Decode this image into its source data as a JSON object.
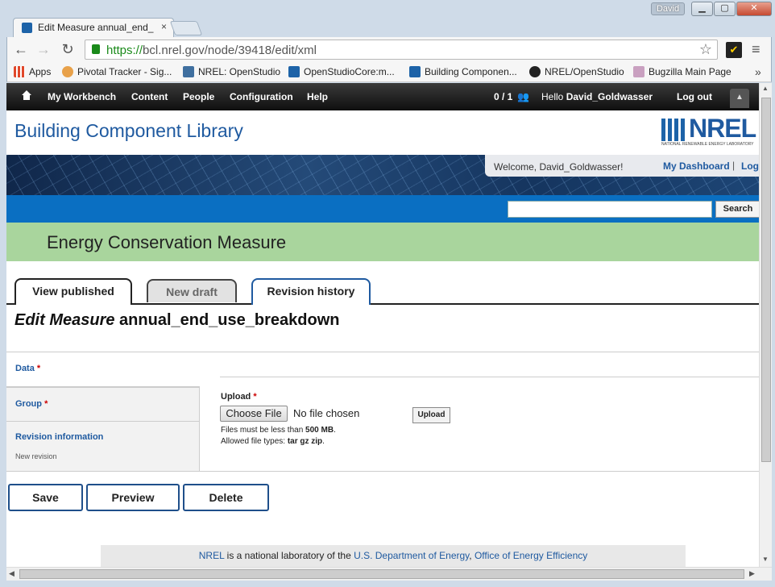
{
  "window": {
    "user_badge": "David",
    "minimize": "▁",
    "maximize": "▢",
    "close": "✕"
  },
  "tab": {
    "title": "Edit Measure annual_end_",
    "close": "×"
  },
  "toolbar": {
    "url_scheme": "https://",
    "url_rest": "bcl.nrel.gov/node/39418/edit/xml",
    "star": "☆",
    "back": "←",
    "forward": "→",
    "reload": "↻",
    "menu": "≡"
  },
  "bookmarks": {
    "items": [
      {
        "label": "Apps",
        "icon": "apps-grid-icon",
        "color": "#e0472a"
      },
      {
        "label": "Pivotal Tracker - Sig...",
        "icon": "pivotal-tracker-icon",
        "color": "#e8a14a"
      },
      {
        "label": "NREL: OpenStudio",
        "icon": "openstudio-icon",
        "color": "#3f6f9f"
      },
      {
        "label": "OpenStudioCore:m...",
        "icon": "openstudio-core-icon",
        "color": "#1d63a8"
      },
      {
        "label": "Building Componen...",
        "icon": "bcl-icon",
        "color": "#1d63a8"
      },
      {
        "label": "NREL/OpenStudio",
        "icon": "github-icon",
        "color": "#222222"
      },
      {
        "label": "Bugzilla Main Page",
        "icon": "bugzilla-icon",
        "color": "#c9a0c0"
      }
    ],
    "more": "»"
  },
  "admin": {
    "workbench": "My Workbench",
    "content": "Content",
    "people": "People",
    "configuration": "Configuration",
    "help": "Help",
    "users": "0 / 1",
    "hello_prefix": "Hello ",
    "hello_user": "David_Goldwasser",
    "logout": "Log out",
    "toggle": "▲"
  },
  "site": {
    "name": "Building Component Library",
    "logo": "NREL",
    "logo_sub": "NATIONAL RENEWABLE ENERGY LABORATORY"
  },
  "welcome": {
    "text": "Welcome, David_Goldwasser!",
    "dashboard": "My Dashboard",
    "sep": "|",
    "logout": "Log"
  },
  "search": {
    "button": "Search",
    "value": ""
  },
  "section": {
    "title": "Energy Conservation Measure"
  },
  "page_tabs": {
    "view_published": "View published",
    "new_draft": "New draft",
    "revision_history": "Revision history"
  },
  "page": {
    "title_em": "Edit Measure",
    "title_name": "annual_end_use_breakdown"
  },
  "vtabs": {
    "data": "Data",
    "group": "Group",
    "revision": "Revision information",
    "revision_sub": "New revision",
    "req": "*"
  },
  "upload": {
    "label": "Upload",
    "req": "*",
    "choose": "Choose File",
    "no_file": "No file chosen",
    "button": "Upload",
    "size_hint_prefix": "Files must be less than ",
    "size_hint_value": "500 MB",
    "size_hint_suffix": ".",
    "types_prefix": "Allowed file types: ",
    "types_value": "tar gz zip",
    "types_suffix": "."
  },
  "actions": {
    "save": "Save",
    "preview": "Preview",
    "delete": "Delete"
  },
  "footer": {
    "nrel": "NREL",
    "mid": " is a national laboratory of the ",
    "doe": "U.S. Department of Energy",
    "comma": ", ",
    "office": "Office of Energy Efficiency"
  }
}
